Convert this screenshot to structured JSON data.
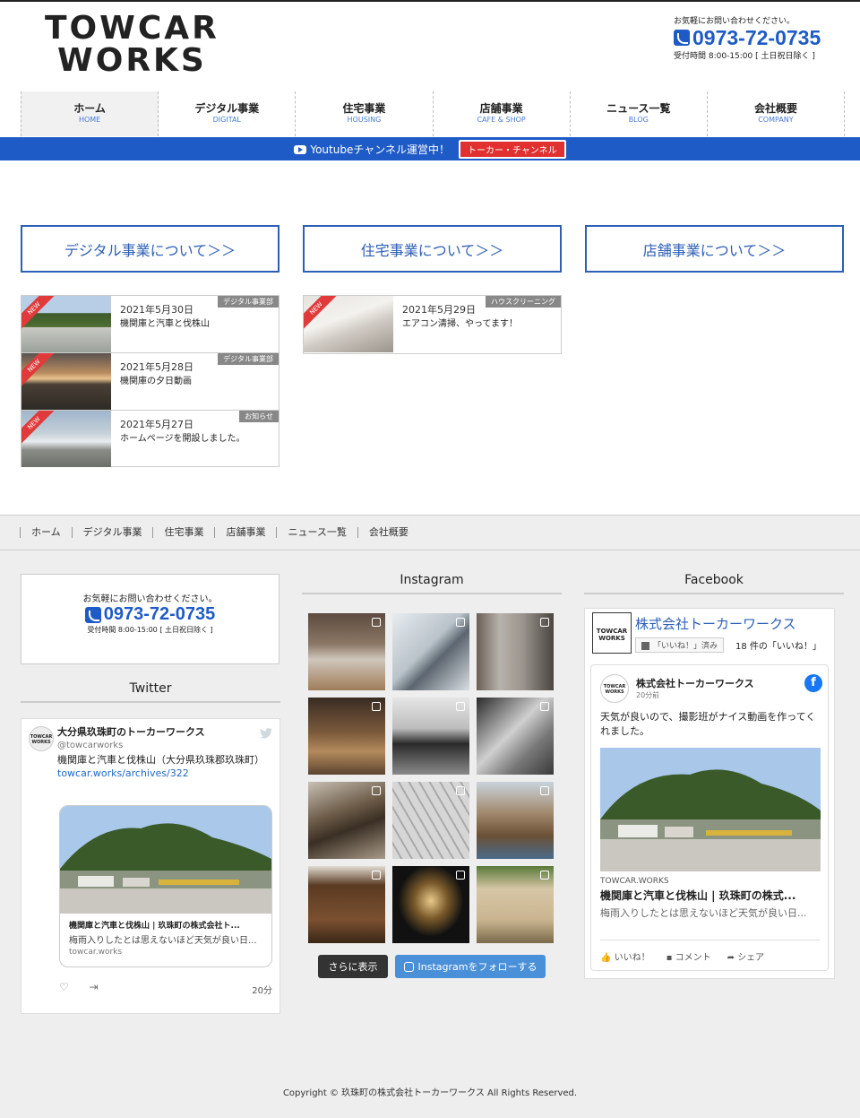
{
  "header": {
    "logo_line1": "TOWCAR",
    "logo_line2": "WORKS",
    "contact_lead": "お気軽にお問い合わせください。",
    "tel": "0973-72-0735",
    "hours": "受付時間 8:00-15:00 [ 土日祝日除く ]"
  },
  "nav": [
    {
      "jp": "ホーム",
      "en": "HOME"
    },
    {
      "jp": "デジタル事業",
      "en": "DIGITAL"
    },
    {
      "jp": "住宅事業",
      "en": "HOUSING"
    },
    {
      "jp": "店舗事業",
      "en": "CAFE & SHOP"
    },
    {
      "jp": "ニュース一覧",
      "en": "BLOG"
    },
    {
      "jp": "会社概要",
      "en": "COMPANY"
    }
  ],
  "youtube_bar": {
    "text": "Youtubeチャンネル運営中！",
    "button": "トーカー・チャンネル"
  },
  "services": [
    {
      "label": "デジタル事業について＞＞"
    },
    {
      "label": "住宅事業について＞＞"
    },
    {
      "label": "店舗事業について＞＞"
    }
  ],
  "posts_left": [
    {
      "date": "2021年5月30日",
      "title": "機関庫と汽車と伐株山",
      "cat": "デジタル事業部",
      "new": "NEW"
    },
    {
      "date": "2021年5月28日",
      "title": "機関庫の夕日動画",
      "cat": "デジタル事業部",
      "new": "NEW"
    },
    {
      "date": "2021年5月27日",
      "title": "ホームページを開設しました。",
      "cat": "お知らせ",
      "new": "NEW"
    }
  ],
  "posts_mid": [
    {
      "date": "2021年5月29日",
      "title": "エアコン清掃、やってます！",
      "cat": "ハウスクリーニング",
      "new": "NEW"
    }
  ],
  "footer_nav": [
    "ホーム",
    "デジタル事業",
    "住宅事業",
    "店舗事業",
    "ニュース一覧",
    "会社概要"
  ],
  "footer_contact": {
    "lead": "お気軽にお問い合わせください。",
    "tel": "0973-72-0735",
    "hours": "受付時間 8:00-15:00 [ 土日祝日除く ]"
  },
  "twitter": {
    "title": "Twitter",
    "name": "大分県玖珠町のトーカーワークス",
    "handle": "@towcarworks",
    "text": "機関庫と汽車と伐株山（大分県玖珠郡玖珠町）",
    "link": "towcar.works/archives/322",
    "card_title": "機関庫と汽車と伐株山 | 玖珠町の株式会社ト...",
    "card_desc": "梅雨入りしたとは思えないほど天気が良い日...",
    "card_url": "towcar.works",
    "time": "20分"
  },
  "instagram": {
    "title": "Instagram",
    "more": "さらに表示",
    "follow": "Instagramをフォローする"
  },
  "facebook": {
    "title": "Facebook",
    "page_name": "株式会社トーカーワークス",
    "like_button": "「いいね！」済み",
    "like_count": "18 件の「いいね！」",
    "post_name": "株式会社トーカーワークス",
    "post_time": "20分前",
    "message": "天気が良いので、撮影班がナイス動画を作ってくれました。",
    "link_domain": "TOWCAR.WORKS",
    "link_title": "機関庫と汽車と伐株山 | 玖珠町の株式...",
    "link_desc": "梅雨入りしたとは思えないほど天気が良い日...",
    "act_like": "いいね！",
    "act_comment": "コメント",
    "act_share": "シェア"
  },
  "copyright": "Copyright © 玖珠町の株式会社トーカーワークス All Rights Reserved.",
  "colors": {
    "brand_blue": "#1e5bc6",
    "new_red": "#e03a3a"
  }
}
